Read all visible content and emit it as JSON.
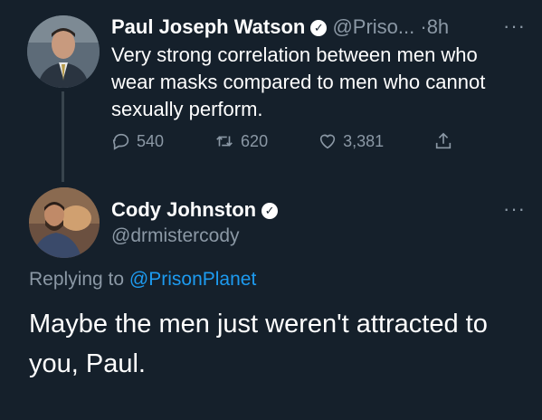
{
  "tweet1": {
    "name": "Paul Joseph Watson",
    "handle": "@Priso...",
    "time": "·8h",
    "text": "Very strong correlation between men who wear masks compared to men who cannot sexually perform.",
    "replies": "540",
    "retweets": "620",
    "likes": "3,381",
    "more": "···"
  },
  "tweet2": {
    "name": "Cody Johnston",
    "handle": "@drmistercody",
    "more": "···",
    "replying_label": "Replying to",
    "replying_handle": "@PrisonPlanet",
    "text": "Maybe the men just weren't attracted to you, Paul."
  },
  "colors": {
    "background": "#15202b",
    "link": "#1d9bf0",
    "muted": "#8b98a5"
  }
}
